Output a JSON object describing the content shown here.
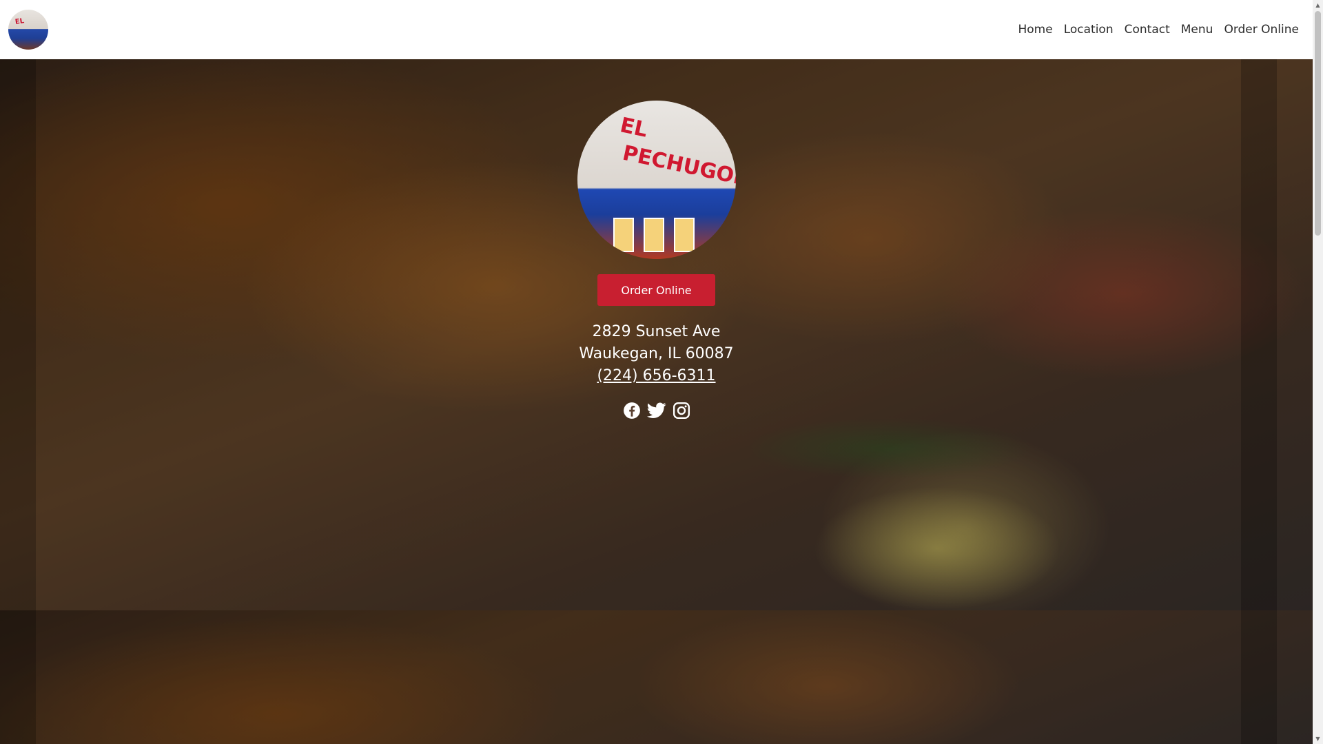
{
  "nav": {
    "logo_alt": "El Pechugon",
    "links": [
      "Home",
      "Location",
      "Contact",
      "Menu",
      "Order Online"
    ]
  },
  "hero": {
    "logo_sign_line1": "EL",
    "logo_sign_line2": "PECHUGON",
    "order_button": "Order Online",
    "address_line1": "2829 Sunset Ave",
    "address_line2": "Waukegan, IL 60087",
    "phone": "(224) 656-6311",
    "socials": [
      "facebook-icon",
      "twitter-icon",
      "instagram-icon"
    ]
  },
  "colors": {
    "accent": "#c81f30",
    "nav_text": "#2b2b2b",
    "hero_text": "#ffffff"
  }
}
